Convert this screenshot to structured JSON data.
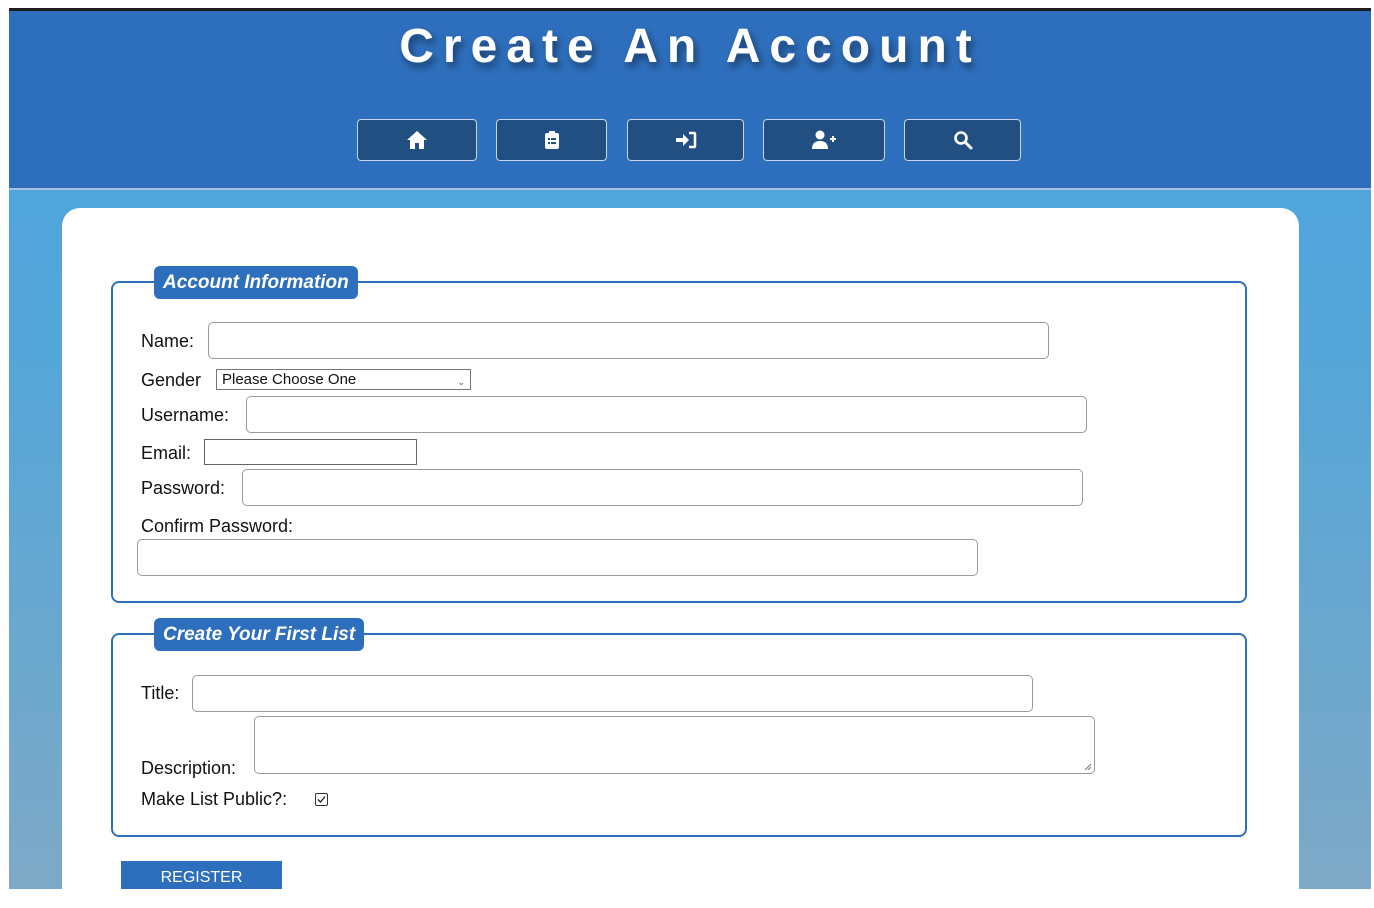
{
  "header": {
    "title": "Create An Account",
    "nav": [
      {
        "name": "nav-home-button",
        "icon": "home-icon"
      },
      {
        "name": "nav-lists-button",
        "icon": "clipboard-list-icon"
      },
      {
        "name": "nav-login-button",
        "icon": "sign-in-icon"
      },
      {
        "name": "nav-register-button",
        "icon": "user-plus-icon"
      },
      {
        "name": "nav-search-button",
        "icon": "search-icon"
      }
    ]
  },
  "account": {
    "legend": "Account Information",
    "name_label": "Name:",
    "name_value": "",
    "gender_label": "Gender",
    "gender_selected": "Please Choose One",
    "username_label": "Username:",
    "username_value": "",
    "email_label": "Email:",
    "email_value": "",
    "password_label": "Password:",
    "password_value": "",
    "confirm_label": "Confirm Password:",
    "confirm_value": ""
  },
  "list": {
    "legend": "Create Your First List",
    "title_label": "Title:",
    "title_value": "",
    "description_label": "Description:",
    "description_value": "",
    "public_label": "Make List Public?:",
    "public_checked": true
  },
  "register_label": "REGISTER",
  "colors": {
    "header": "#2e6fbd",
    "nav_button": "#214f82",
    "accent": "#2e6fbd"
  }
}
